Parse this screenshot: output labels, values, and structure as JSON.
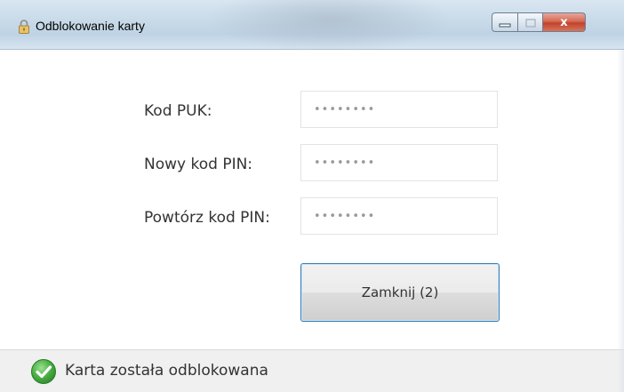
{
  "window": {
    "title": "Odblokowanie karty",
    "title_icon": "lock-icon",
    "controls": {
      "minimize_icon": "minimize-icon",
      "maximize_icon": "maximize-icon",
      "close_glyph": "x"
    }
  },
  "form": {
    "puk": {
      "label": "Kod PUK:",
      "value": "••••••••"
    },
    "new_pin": {
      "label": "Nowy kod PIN:",
      "value": "••••••••"
    },
    "repeat_pin": {
      "label": "Powtórz kod PIN:",
      "value": "••••••••"
    },
    "close_button_label": "Zamknij (2)"
  },
  "status": {
    "icon": "check-circle-icon",
    "text": "Karta została odblokowana",
    "color": "#3fa63f"
  }
}
